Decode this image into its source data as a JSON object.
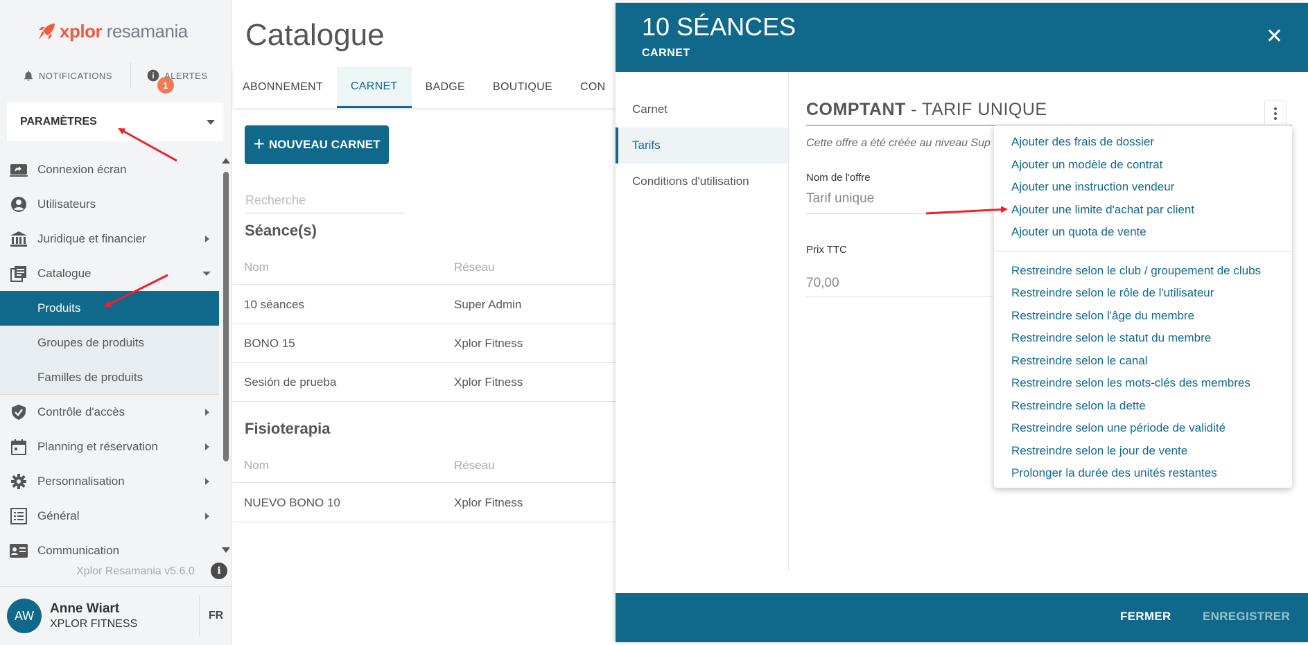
{
  "brand": {
    "part1": "xplor",
    "part2": " resamania",
    "color": "#f05a3c"
  },
  "topbar": {
    "notifications": "NOTIFICATIONS",
    "alerts": "ALERTES",
    "alerts_count": "1"
  },
  "settings_dropdown": {
    "label": "PARAMÈTRES"
  },
  "sidebar": {
    "items": [
      {
        "label": "Connexion écran",
        "icon": "screen-share-icon"
      },
      {
        "label": "Utilisateurs",
        "icon": "user-circle-icon"
      },
      {
        "label": "Juridique et financier",
        "icon": "bank-icon"
      },
      {
        "label": "Catalogue",
        "icon": "catalog-icon"
      },
      {
        "label": "Produits"
      },
      {
        "label": "Groupes de produits"
      },
      {
        "label": "Familles de produits"
      },
      {
        "label": "Contrôle d'accès",
        "icon": "shield-check-icon"
      },
      {
        "label": "Planning et réservation",
        "icon": "calendar-icon"
      },
      {
        "label": "Personnalisation",
        "icon": "gear-icon"
      },
      {
        "label": "Général",
        "icon": "list-icon"
      },
      {
        "label": "Communication",
        "icon": "contact-card-icon"
      }
    ]
  },
  "version": "Xplor Resamania v5.6.0",
  "user": {
    "initials": "AW",
    "name": "Anne Wiart",
    "company": "XPLOR FITNESS",
    "lang": "FR"
  },
  "catalogue": {
    "title": "Catalogue",
    "tabs": [
      "ABONNEMENT",
      "CARNET",
      "BADGE",
      "BOUTIQUE",
      "CON"
    ],
    "new_button": "NOUVEAU CARNET",
    "search_placeholder": "Recherche",
    "sections": [
      {
        "title": "Séance(s)",
        "col_name": "Nom",
        "col_network": "Réseau",
        "rows": [
          {
            "name": "10 séances",
            "network": "Super Admin"
          },
          {
            "name": "BONO 15",
            "network": "Xplor Fitness"
          },
          {
            "name": "Sesión de prueba",
            "network": "Xplor Fitness"
          }
        ]
      },
      {
        "title": "Fisioterapia",
        "col_name": "Nom",
        "col_network": "Réseau",
        "rows": [
          {
            "name": "NUEVO BONO 10",
            "network": "Xplor Fitness"
          }
        ]
      }
    ]
  },
  "panel": {
    "title": "10 SÉANCES",
    "subtitle": "CARNET",
    "nav": [
      "Carnet",
      "Tarifs",
      "Conditions d'utilisation"
    ],
    "offer_head_bold": "COMPTANT",
    "offer_head_rest": " - TARIF UNIQUE",
    "offer_note": "Cette offre a été créée au niveau Sup",
    "offer_name_label": "Nom de l'offre",
    "offer_name_value": "Tarif unique",
    "price_label": "Prix TTC",
    "price_value": "70,00",
    "close_button": "FERMER",
    "save_button": "ENREGISTRER"
  },
  "menu": {
    "group1": [
      "Ajouter des frais de dossier",
      "Ajouter un modèle de contrat",
      "Ajouter une instruction vendeur",
      "Ajouter une limite d'achat par client",
      "Ajouter un quota de vente"
    ],
    "group2": [
      "Restreindre selon le club / groupement de clubs",
      "Restreindre selon le rôle de l'utilisateur",
      "Restreindre selon l'âge du membre",
      "Restreindre selon le statut du membre",
      "Restreindre selon le canal",
      "Restreindre selon les mots-clés des membres",
      "Restreindre selon la dette",
      "Restreindre selon une période de validité",
      "Restreindre selon le jour de vente",
      "Prolonger la durée des unités restantes"
    ]
  },
  "colors": {
    "primary": "#10698b",
    "accent": "#f05a3c",
    "annotation_arrow": "#e8232b"
  }
}
